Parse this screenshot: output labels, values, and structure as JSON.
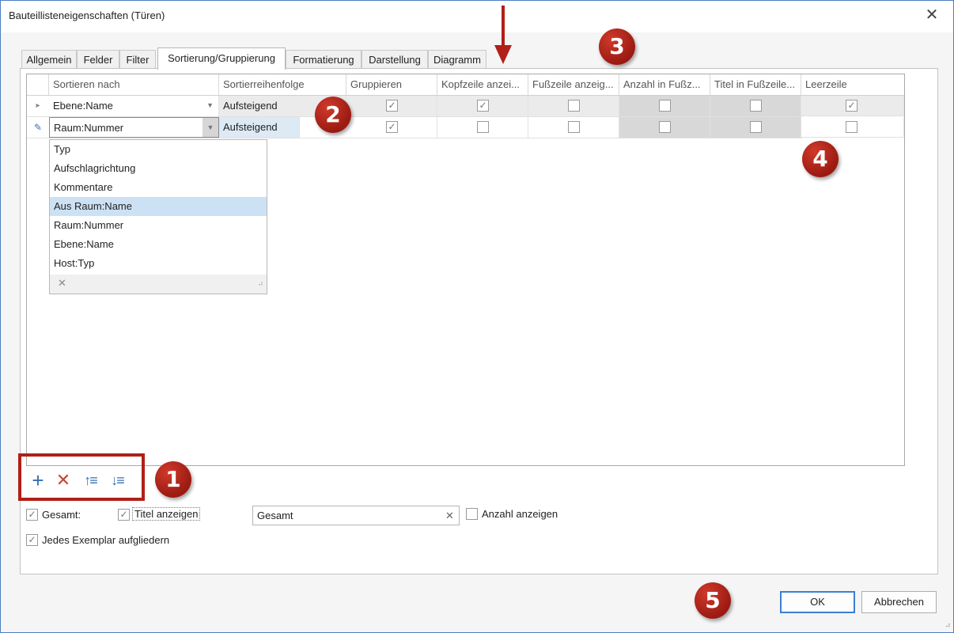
{
  "window": {
    "title": "Bauteillisteneigenschaften (Türen)",
    "close_glyph": "✕"
  },
  "tabs": [
    {
      "label": "Allgemein",
      "active": false
    },
    {
      "label": "Felder",
      "active": false
    },
    {
      "label": "Filter",
      "active": false
    },
    {
      "label": "Sortierung/Gruppierung",
      "active": true
    },
    {
      "label": "Formatierung",
      "active": false
    },
    {
      "label": "Darstellung",
      "active": false
    },
    {
      "label": "Diagramm",
      "active": false
    }
  ],
  "grid": {
    "columns": [
      "Sortieren nach",
      "Sortierreihenfolge",
      "Gruppieren",
      "Kopfzeile anzei...",
      "Fußzeile anzeig...",
      "Anzahl in Fußz...",
      "Titel in Fußzeile...",
      "Leerzeile"
    ],
    "rows": [
      {
        "indicator": "▸",
        "sort_by": "Ebene:Name",
        "order": "Aufsteigend",
        "group": true,
        "header": true,
        "footer": false,
        "count": false,
        "title": false,
        "blank": true
      },
      {
        "indicator": "✎",
        "sort_by": "Raum:Nummer",
        "order": "Aufsteigend",
        "group": true,
        "header": false,
        "footer": false,
        "count": false,
        "title": false,
        "blank": false
      }
    ]
  },
  "dropdown": {
    "items": [
      "Typ",
      "Aufschlagrichtung",
      "Kommentare",
      "Aus Raum:Name",
      "Raum:Nummer",
      "Ebene:Name",
      "Host:Typ"
    ],
    "selected_index": 3,
    "clear_glyph": "✕"
  },
  "toolbar": {
    "add_glyph": "+",
    "delete_glyph": "✕",
    "move_up_glyph": "↑≡",
    "move_down_glyph": "↓≡"
  },
  "options": {
    "total_label": "Gesamt:",
    "total_checked": true,
    "show_title_label": "Titel anzeigen",
    "show_title_checked": true,
    "total_value": "Gesamt",
    "show_count_label": "Anzahl anzeigen",
    "show_count_checked": false,
    "itemize_label": "Jedes Exemplar aufgliedern",
    "itemize_checked": true
  },
  "buttons": {
    "ok": "OK",
    "cancel": "Abbrechen"
  },
  "annotations": [
    "1",
    "2",
    "3",
    "4",
    "5"
  ],
  "colors": {
    "badge": "#b02018",
    "selection": "#cde1f4",
    "accent": "#3c7fd0"
  }
}
